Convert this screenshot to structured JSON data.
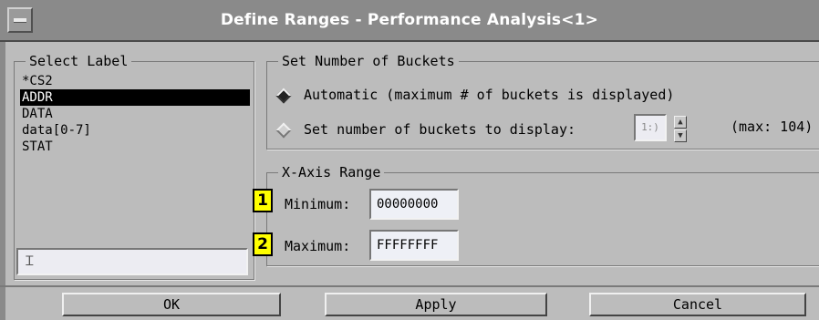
{
  "window": {
    "title": "Define Ranges - Performance Analysis<1>"
  },
  "select_label": {
    "legend": "Select Label",
    "items": [
      "*CS2",
      "ADDR",
      "DATA",
      "data[0-7]",
      "STAT"
    ],
    "selected_index": 1,
    "input_value": ""
  },
  "buckets": {
    "legend": "Set Number of Buckets",
    "option_automatic": "Automatic (maximum # of buckets is displayed)",
    "option_set": "Set number of buckets to display:",
    "selected": "automatic",
    "count_value": "1:)",
    "max_text": "(max: 104)"
  },
  "xaxis": {
    "legend": "X-Axis Range",
    "minimum_label": "Minimum:",
    "minimum_value": "00000000",
    "maximum_label": "Maximum:",
    "maximum_value": "FFFFFFFF",
    "callouts": [
      "1",
      "2"
    ],
    "callout_color": "#ffff00"
  },
  "buttons": {
    "ok": "OK",
    "apply": "Apply",
    "cancel": "Cancel"
  }
}
